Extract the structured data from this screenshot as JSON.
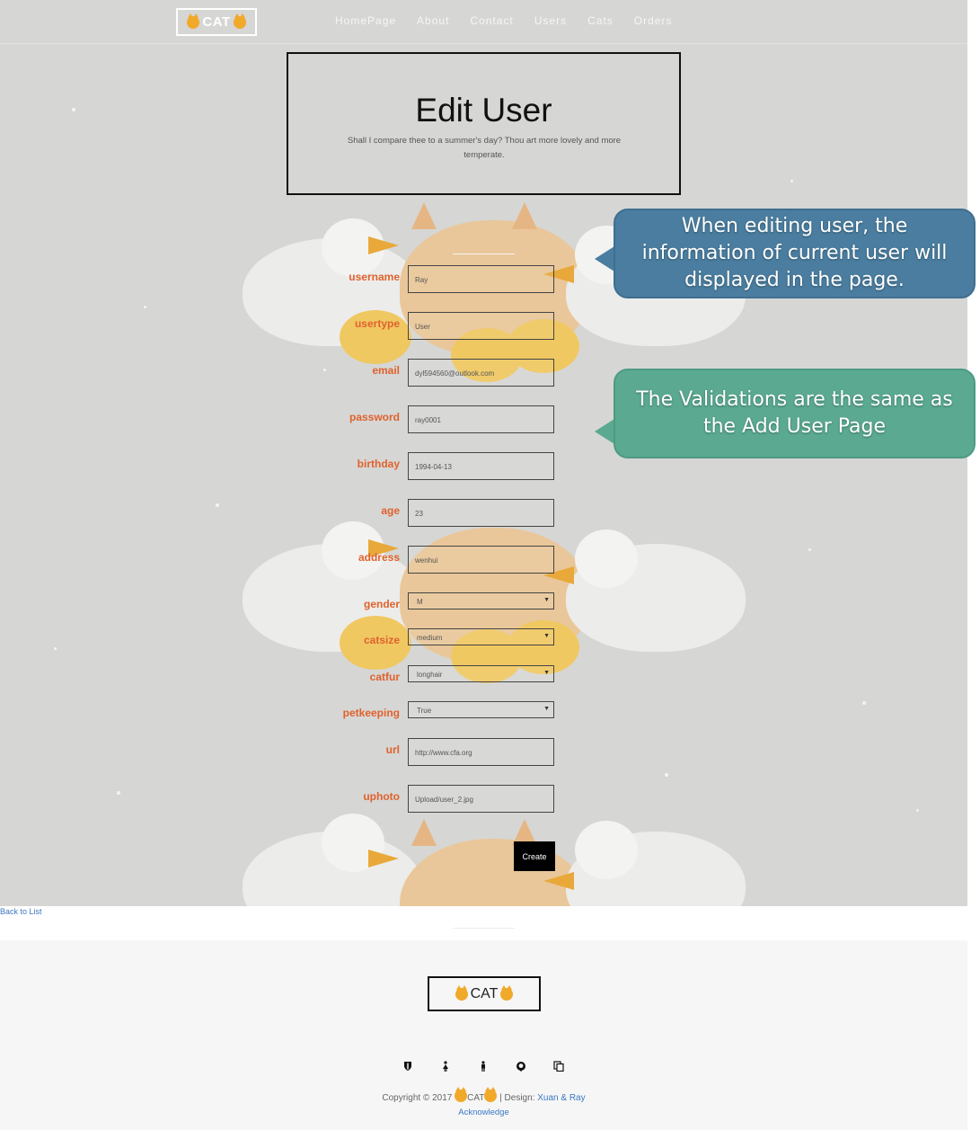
{
  "nav": {
    "logo": "CAT",
    "links": [
      "HomePage",
      "About",
      "Contact",
      "Users",
      "Cats",
      "Orders"
    ]
  },
  "header": {
    "title": "Edit User",
    "subtitle": "Shall I compare thee to a summer's day? Thou art more lovely and more temperate."
  },
  "form": {
    "username": {
      "label": "username",
      "value": "Ray"
    },
    "usertype": {
      "label": "usertype",
      "value": "User"
    },
    "email": {
      "label": "email",
      "value": "dyl594560@outlook.com"
    },
    "password": {
      "label": "password",
      "value": "ray0001"
    },
    "birthday": {
      "label": "birthday",
      "value": "1994-04-13"
    },
    "age": {
      "label": "age",
      "value": "23"
    },
    "address": {
      "label": "address",
      "value": "wenhui"
    },
    "gender": {
      "label": "gender",
      "value": "M"
    },
    "catsize": {
      "label": "catsize",
      "value": "medium"
    },
    "catfur": {
      "label": "catfur",
      "value": "longhair"
    },
    "petkeeping": {
      "label": "petkeeping",
      "value": "True"
    },
    "url": {
      "label": "url",
      "value": "http://www.cfa.org"
    },
    "uphoto": {
      "label": "uphoto",
      "value": "Upload/user_2.jpg"
    },
    "submit_label": "Create"
  },
  "callouts": {
    "editing": "When editing user, the information of current user will displayed in the page.",
    "validation": "The Validations are the same as the Add User Page"
  },
  "back_link": "Back to List",
  "footer": {
    "logo": "CAT",
    "copyright_prefix": "Copyright © 2017",
    "copyright_brand": "CAT",
    "copyright_design": "| Design:",
    "designers": "Xuan & Ray",
    "acknowledge": "Acknowledge",
    "social_icons": [
      "shield-icon",
      "female-icon",
      "male-icon",
      "github-icon",
      "copy-icon"
    ]
  },
  "colors": {
    "hero_bg": "#d6d6d4",
    "label": "#e0622d",
    "link": "#3a78c2",
    "callout_blue": "#4a7d9f",
    "callout_green": "#5aa990"
  }
}
